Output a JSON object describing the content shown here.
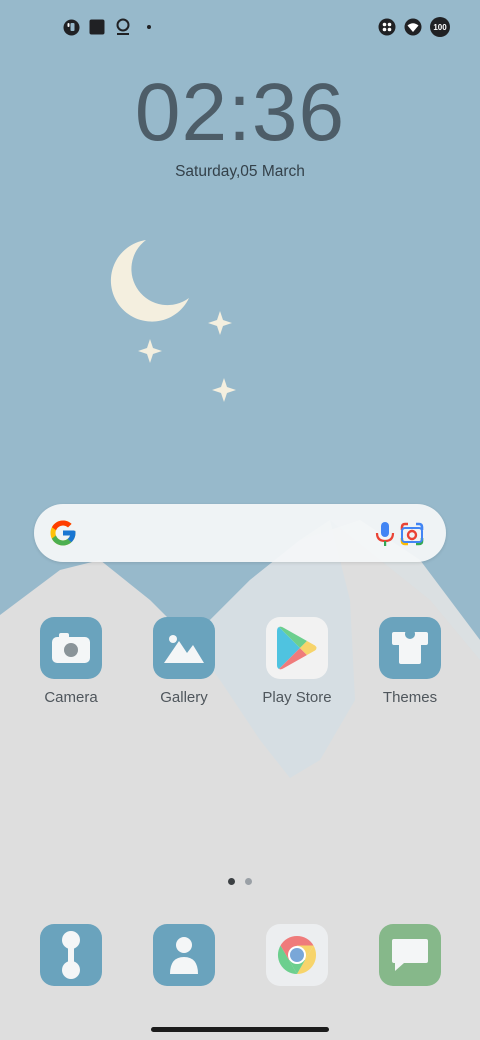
{
  "status_bar": {
    "left_icons": [
      "app-notification-icon",
      "square-notification-icon",
      "assistant-notification-icon",
      "more-dot-icon"
    ],
    "right_icons": [
      "dual-sim-icon",
      "wifi-icon"
    ],
    "battery": "100"
  },
  "lockscreen": {
    "time": "02:36",
    "date": "Saturday,05 March"
  },
  "search": {
    "icons": [
      "google-logo-icon",
      "microphone-icon",
      "google-lens-icon"
    ]
  },
  "apps": [
    {
      "label": "Camera",
      "icon": "camera-icon",
      "color": "#6aa3bd"
    },
    {
      "label": "Gallery",
      "icon": "gallery-icon",
      "color": "#6aa3bd"
    },
    {
      "label": "Play Store",
      "icon": "play-store-icon",
      "color": "#f2f2f2"
    },
    {
      "label": "Themes",
      "icon": "themes-icon",
      "color": "#6aa3bd"
    }
  ],
  "page_indicator": {
    "pages": 2,
    "current": 1
  },
  "dock": [
    {
      "icon": "phone-icon",
      "color": "#6aa3bd"
    },
    {
      "icon": "contacts-icon",
      "color": "#6aa3bd"
    },
    {
      "icon": "chrome-icon",
      "color": "#eceef0"
    },
    {
      "icon": "messages-icon",
      "color": "#86b88a"
    }
  ],
  "colors": {
    "sky": "#97b9cb",
    "ground": "#dedede",
    "mountain_light": "#d3dee4",
    "moon": "#f4efdf"
  }
}
